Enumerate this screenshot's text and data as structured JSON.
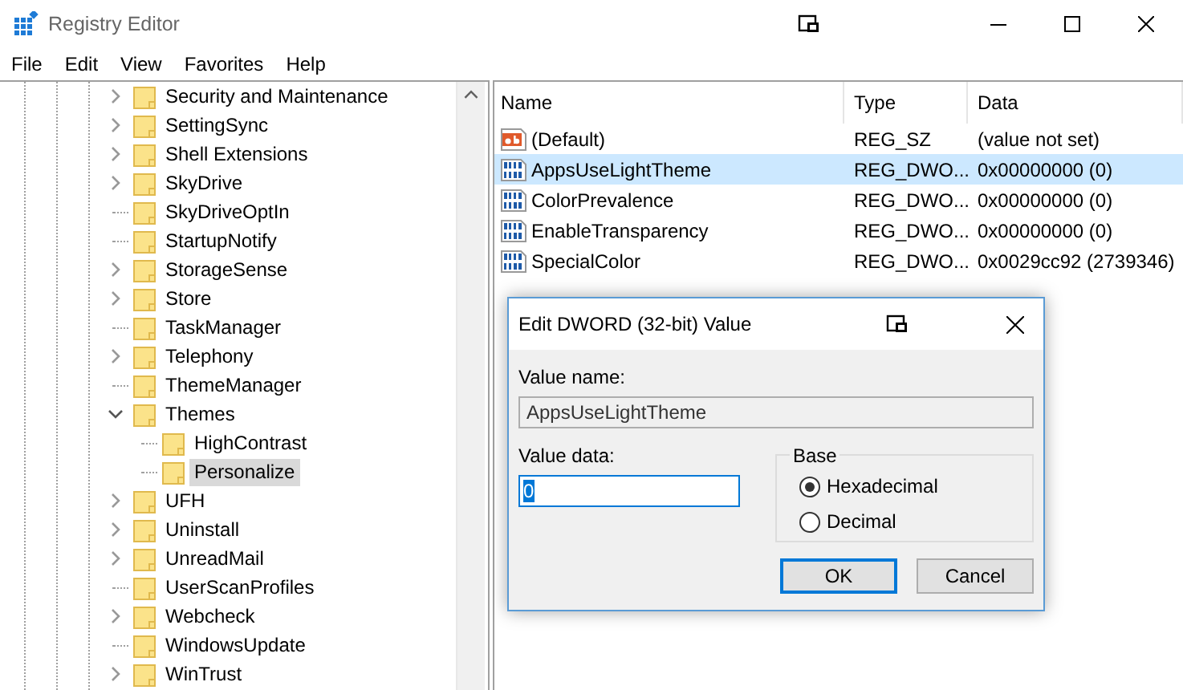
{
  "window": {
    "title": "Registry Editor"
  },
  "menu": [
    "File",
    "Edit",
    "View",
    "Favorites",
    "Help"
  ],
  "tree": [
    {
      "label": "Security and Maintenance",
      "expandable": true,
      "expanded": false,
      "selected": false
    },
    {
      "label": "SettingSync",
      "expandable": true,
      "expanded": false,
      "selected": false
    },
    {
      "label": "Shell Extensions",
      "expandable": true,
      "expanded": false,
      "selected": false
    },
    {
      "label": "SkyDrive",
      "expandable": true,
      "expanded": false,
      "selected": false
    },
    {
      "label": "SkyDriveOptIn",
      "expandable": false,
      "selected": false
    },
    {
      "label": "StartupNotify",
      "expandable": false,
      "selected": false
    },
    {
      "label": "StorageSense",
      "expandable": true,
      "expanded": false,
      "selected": false
    },
    {
      "label": "Store",
      "expandable": true,
      "expanded": false,
      "selected": false
    },
    {
      "label": "TaskManager",
      "expandable": false,
      "selected": false
    },
    {
      "label": "Telephony",
      "expandable": true,
      "expanded": false,
      "selected": false
    },
    {
      "label": "ThemeManager",
      "expandable": false,
      "selected": false
    },
    {
      "label": "Themes",
      "expandable": true,
      "expanded": true,
      "selected": false,
      "children": [
        {
          "label": "HighContrast",
          "expandable": false,
          "selected": false
        },
        {
          "label": "Personalize",
          "expandable": false,
          "selected": true
        }
      ]
    },
    {
      "label": "UFH",
      "expandable": true,
      "expanded": false,
      "selected": false
    },
    {
      "label": "Uninstall",
      "expandable": true,
      "expanded": false,
      "selected": false
    },
    {
      "label": "UnreadMail",
      "expandable": true,
      "expanded": false,
      "selected": false
    },
    {
      "label": "UserScanProfiles",
      "expandable": false,
      "selected": false
    },
    {
      "label": "Webcheck",
      "expandable": true,
      "expanded": false,
      "selected": false
    },
    {
      "label": "WindowsUpdate",
      "expandable": false,
      "selected": false
    },
    {
      "label": "WinTrust",
      "expandable": true,
      "expanded": false,
      "selected": false
    }
  ],
  "values": {
    "columns": [
      "Name",
      "Type",
      "Data"
    ],
    "rows": [
      {
        "kind": "string",
        "name": "(Default)",
        "type": "REG_SZ",
        "data": "(value not set)",
        "selected": false
      },
      {
        "kind": "dword",
        "name": "AppsUseLightTheme",
        "type": "REG_DWO...",
        "data": "0x00000000 (0)",
        "selected": true
      },
      {
        "kind": "dword",
        "name": "ColorPrevalence",
        "type": "REG_DWO...",
        "data": "0x00000000 (0)",
        "selected": false
      },
      {
        "kind": "dword",
        "name": "EnableTransparency",
        "type": "REG_DWO...",
        "data": "0x00000000 (0)",
        "selected": false
      },
      {
        "kind": "dword",
        "name": "SpecialColor",
        "type": "REG_DWO...",
        "data": "0x0029cc92 (2739346)",
        "selected": false
      }
    ]
  },
  "dialog": {
    "title": "Edit DWORD (32-bit) Value",
    "value_name_label": "Value name:",
    "value_name": "AppsUseLightTheme",
    "value_data_label": "Value data:",
    "value_data": "0",
    "base_label": "Base",
    "base_options": [
      {
        "label": "Hexadecimal",
        "selected": true
      },
      {
        "label": "Decimal",
        "selected": false
      }
    ],
    "buttons": [
      {
        "label": "OK",
        "default": true
      },
      {
        "label": "Cancel",
        "default": false
      }
    ]
  }
}
